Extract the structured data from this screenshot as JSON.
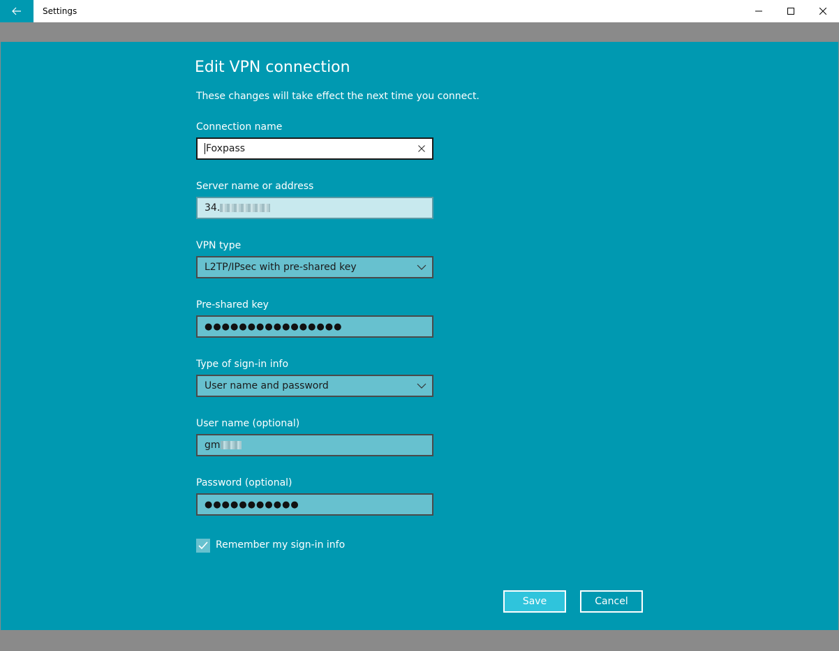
{
  "window": {
    "title": "Settings",
    "back_icon": "arrow-left-icon",
    "minimize_icon": "minimize-icon",
    "maximize_icon": "maximize-icon",
    "close_icon": "close-icon"
  },
  "dialog": {
    "title": "Edit VPN connection",
    "subtitle": "These changes will take effect the next time you connect."
  },
  "fields": {
    "connection_name": {
      "label": "Connection name",
      "value": "Foxpass"
    },
    "server": {
      "label": "Server name or address",
      "value": "34."
    },
    "vpn_type": {
      "label": "VPN type",
      "value": "L2TP/IPsec with pre-shared key"
    },
    "psk": {
      "label": "Pre-shared key",
      "value": "●●●●●●●●●●●●●●●●"
    },
    "signin_type": {
      "label": "Type of sign-in info",
      "value": "User name and password"
    },
    "username": {
      "label": "User name (optional)",
      "value": "gm"
    },
    "password": {
      "label": "Password (optional)",
      "value": "●●●●●●●●●●●"
    }
  },
  "remember": {
    "label": "Remember my sign-in info",
    "checked": true
  },
  "buttons": {
    "save": "Save",
    "cancel": "Cancel"
  },
  "colors": {
    "accent": "#0099b1",
    "field_bg": "#67c1cf",
    "save_bg": "#2fc4dc"
  }
}
